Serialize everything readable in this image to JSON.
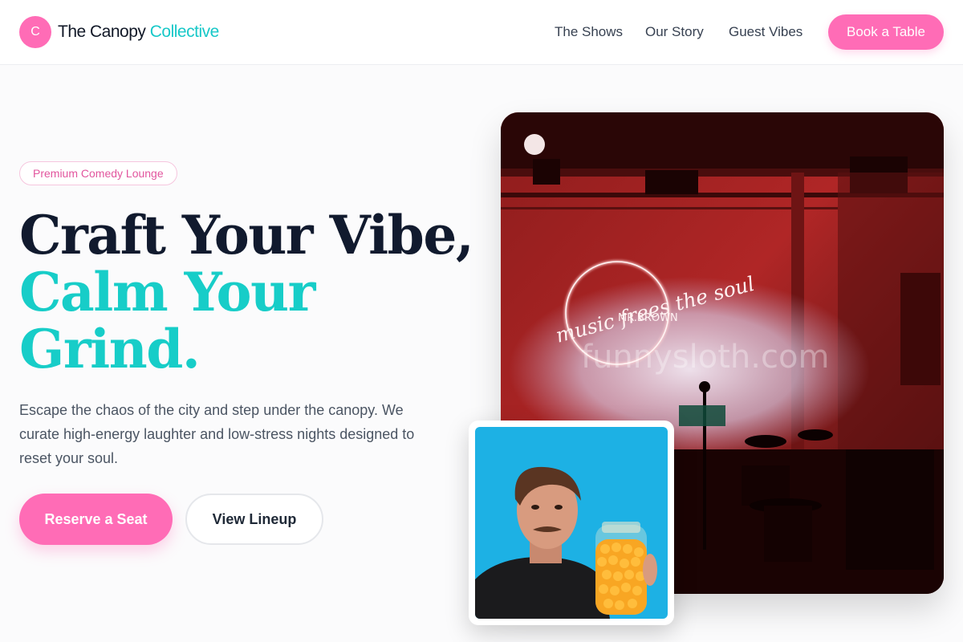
{
  "header": {
    "logo_badge": "C",
    "logo_main": "The Canopy",
    "logo_accent": "Collective",
    "nav": [
      "The Shows",
      "Our Story",
      "Guest Vibes"
    ],
    "cta": "Book a Table"
  },
  "hero": {
    "tag": "Premium Comedy Lounge",
    "headline_line1": "Craft Your Vibe,",
    "headline_line2": "Calm Your",
    "headline_line3": "Grind.",
    "description": "Escape the chaos of the city and step under the canopy. We curate high-energy laughter and low-stress nights designed to reset your soul.",
    "primary_button": "Reserve a Seat",
    "secondary_button": "View Lineup"
  },
  "stage_photo": {
    "neon_script": "music frees the soul",
    "neon_name": "MR.BROWN",
    "watermark": "funnysloth.com"
  },
  "colors": {
    "pink": "#ff6cb6",
    "teal": "#17cdc8",
    "navy": "#111a2e"
  }
}
